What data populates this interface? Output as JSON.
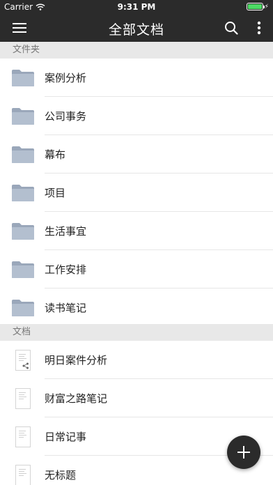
{
  "status_bar": {
    "carrier": "Carrier",
    "time": "9:31 PM",
    "battery_color": "#4cd964"
  },
  "nav": {
    "title": "全部文档",
    "menu_icon": "hamburger-icon",
    "search_icon": "search-icon",
    "more_icon": "more-vertical-icon"
  },
  "folders_section": {
    "title": "文件夹",
    "items": [
      {
        "label": "案例分析"
      },
      {
        "label": "公司事务"
      },
      {
        "label": "幕布"
      },
      {
        "label": "项目"
      },
      {
        "label": "生活事宜"
      },
      {
        "label": "工作安排"
      },
      {
        "label": "读书笔记"
      }
    ]
  },
  "docs_section": {
    "title": "文档",
    "items": [
      {
        "label": "明日案件分析",
        "shared": true
      },
      {
        "label": "财富之路笔记",
        "shared": false
      },
      {
        "label": "日常记事",
        "shared": false
      },
      {
        "label": "无标题",
        "shared": false
      }
    ]
  },
  "fab": {
    "icon": "plus-icon"
  },
  "colors": {
    "bar_bg": "#2b2b2b",
    "section_bg": "#e8e8e8",
    "folder_color": "#aab6c8"
  }
}
